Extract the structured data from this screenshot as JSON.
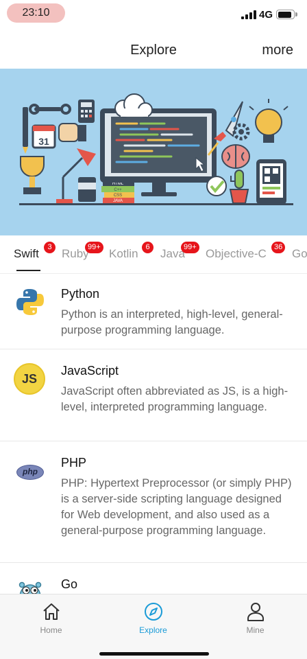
{
  "status_bar": {
    "time": "23:10",
    "network": "4G",
    "battery_level": 0.9
  },
  "nav": {
    "title": "Explore",
    "more_label": "more"
  },
  "banner": {
    "tags": [
      "HTML",
      "C++",
      "CSS",
      "JAVA"
    ],
    "calendar_day": "31"
  },
  "tabs": [
    {
      "label": "Swift",
      "badge": "3",
      "active": true
    },
    {
      "label": "Ruby",
      "badge": "99+",
      "active": false
    },
    {
      "label": "Kotlin",
      "badge": "6",
      "active": false
    },
    {
      "label": "Java",
      "badge": "99+",
      "active": false
    },
    {
      "label": "Objective-C",
      "badge": "36",
      "active": false
    },
    {
      "label": "Go",
      "badge": "",
      "active": false
    }
  ],
  "items": [
    {
      "title": "Python",
      "desc": "Python is an interpreted, high-level, general-purpose programming language.",
      "icon": "python-logo"
    },
    {
      "title": "JavaScript",
      "desc": "JavaScript often abbreviated as JS, is a high-level, interpreted programming language.",
      "icon": "javascript-logo",
      "icon_text": "JS"
    },
    {
      "title": "PHP",
      "desc": "PHP: Hypertext Preprocessor (or simply PHP) is a server-side scripting language designed for Web development, and also used as a general-purpose programming language.",
      "icon": "php-logo",
      "icon_text": "php"
    },
    {
      "title": "Go",
      "desc": "",
      "icon": "go-gopher"
    }
  ],
  "tab_bar": [
    {
      "label": "Home",
      "icon": "home-icon",
      "active": false
    },
    {
      "label": "Explore",
      "icon": "compass-icon",
      "active": true
    },
    {
      "label": "Mine",
      "icon": "person-icon",
      "active": false
    }
  ],
  "colors": {
    "accent": "#1a9bd7",
    "badge": "#e6151b",
    "banner_bg": "#a6d3ee"
  }
}
